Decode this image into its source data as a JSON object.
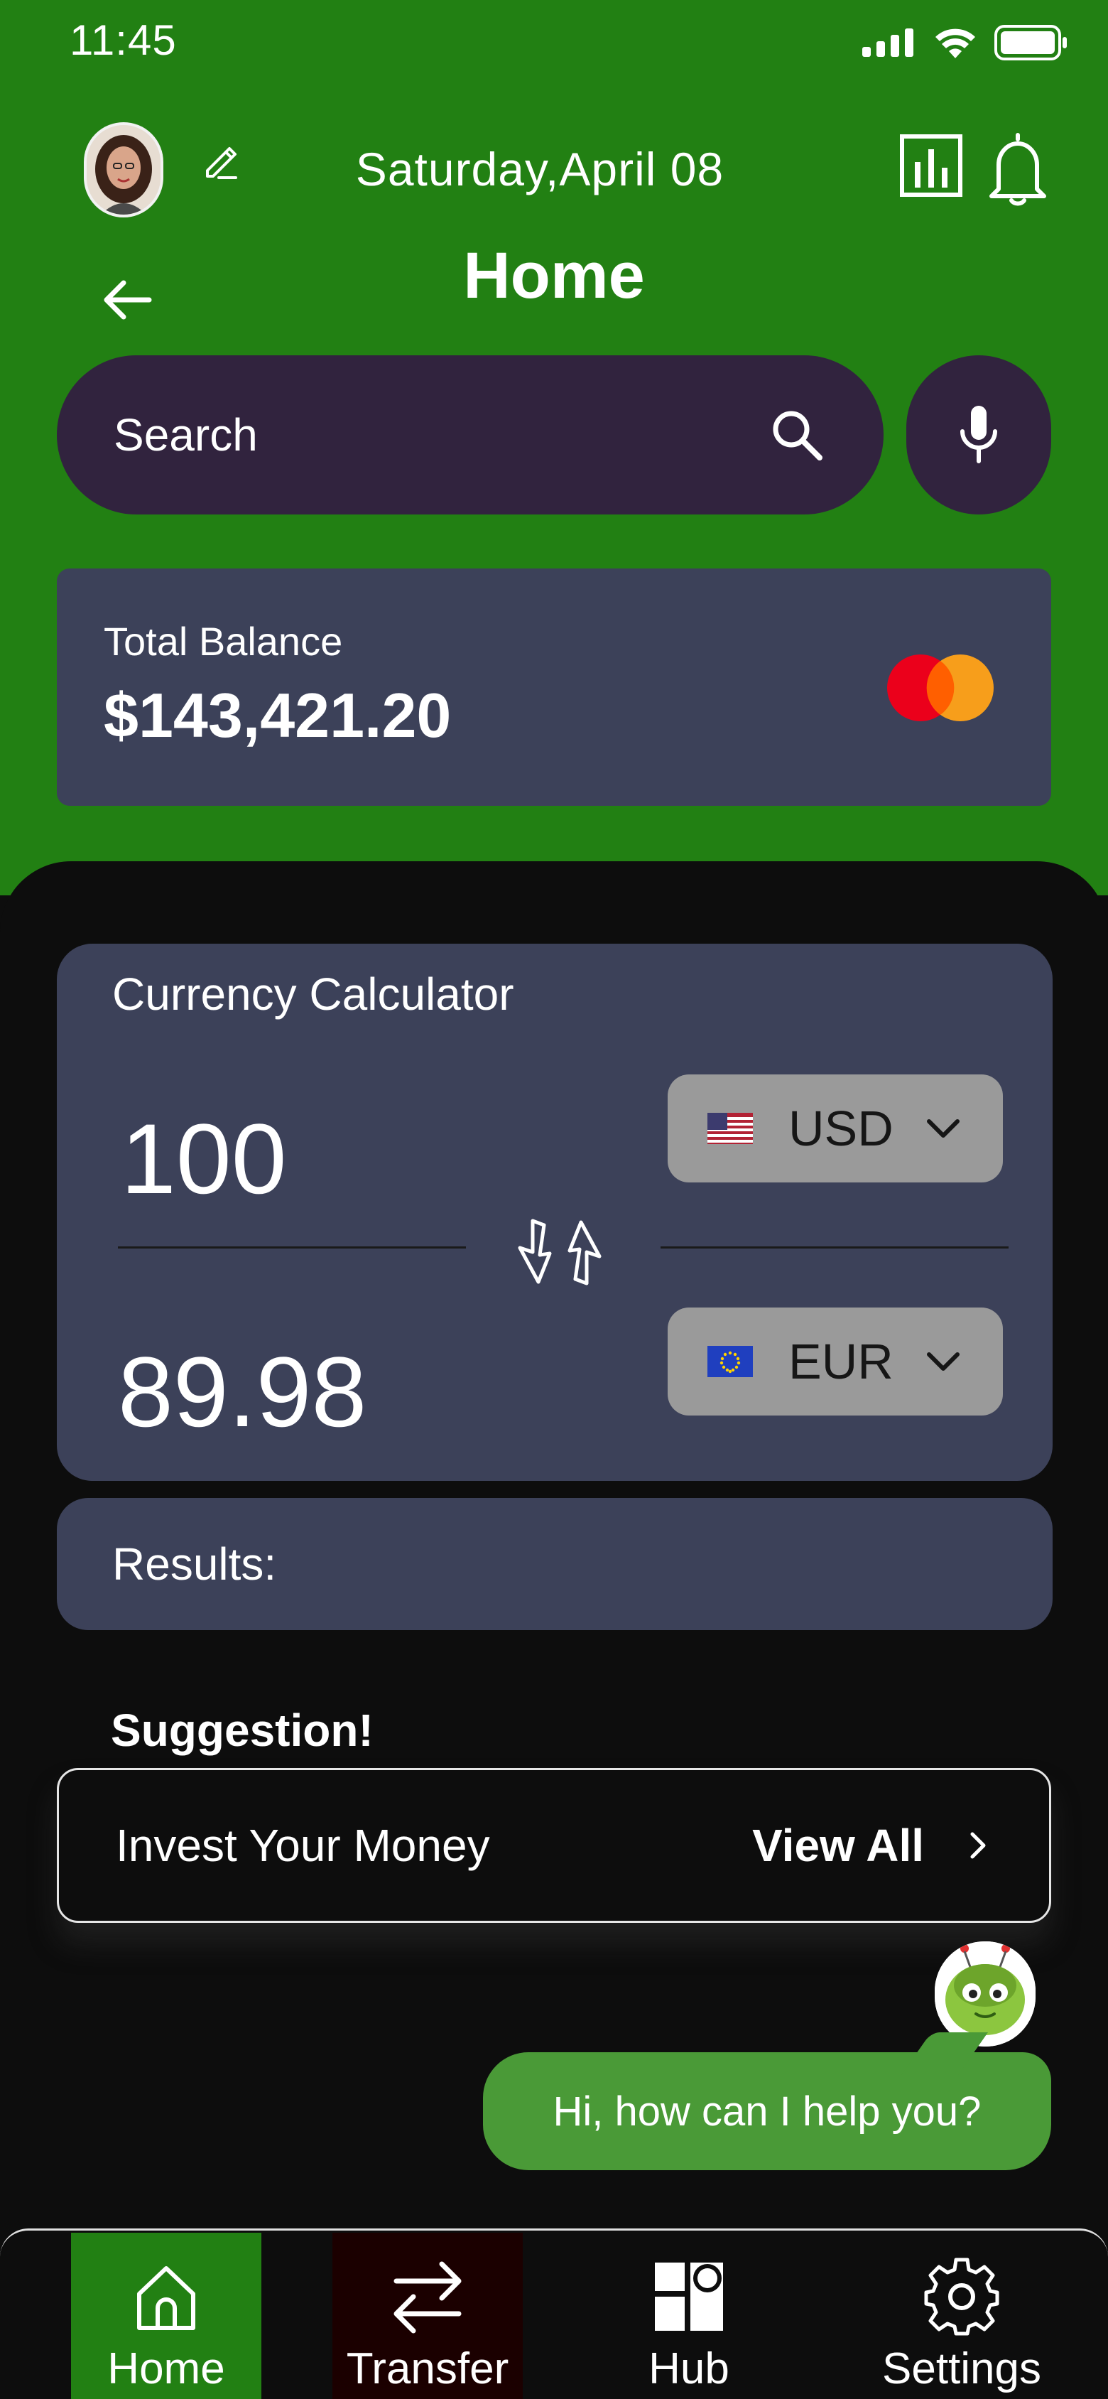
{
  "status_bar": {
    "time": "11:45"
  },
  "header": {
    "date": "Saturday,April 08",
    "title": "Home"
  },
  "search": {
    "placeholder": "Search"
  },
  "balance": {
    "label": "Total Balance",
    "value": "$143,421.20"
  },
  "calculator": {
    "title": "Currency Calculator",
    "from_amount": "100",
    "to_amount": "89.98",
    "from_currency": "USD",
    "to_currency": "EUR"
  },
  "results": {
    "label": "Results:"
  },
  "suggestion": {
    "title": "Suggestion!",
    "item_label": "Invest Your Money",
    "view_all": "View All"
  },
  "chat": {
    "message": "Hi, how can I help you?"
  },
  "nav": {
    "items": [
      {
        "label": "Home",
        "icon": "home-icon",
        "active": true
      },
      {
        "label": "Transfer",
        "icon": "transfer-icon"
      },
      {
        "label": "Hub",
        "icon": "hub-icon"
      },
      {
        "label": "Settings",
        "icon": "gear-icon"
      }
    ]
  },
  "colors": {
    "header_green": "#228013",
    "search_purple": "#31233e",
    "card_slate": "#3c4159",
    "background": "#0d0d0d",
    "chat_green": "#4a9a37"
  }
}
